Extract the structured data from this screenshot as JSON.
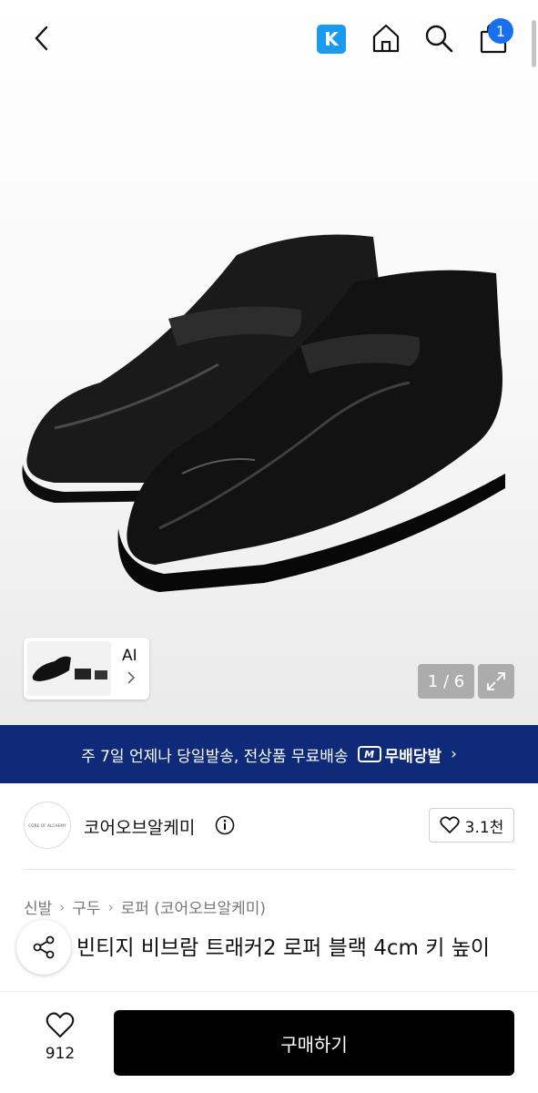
{
  "header": {
    "k_label": "K",
    "cart_count": "1"
  },
  "gallery": {
    "thumb_label": "AI",
    "pager": "1 / 6"
  },
  "banner": {
    "text": "주 7일 언제나 당일발송, 전상품 무료배송",
    "badge_letter": "M",
    "tag": "무배당발",
    "chevron": "›"
  },
  "seller": {
    "logo_text": "CORE OF ALCHEMY",
    "name": "코어오브알케미",
    "likes": "3.1천"
  },
  "breadcrumb": {
    "items": [
      "신발",
      "구두",
      "로퍼 (코어오브알케미)"
    ]
  },
  "product": {
    "title": "빈티지 비브람 트래커2 로퍼 블랙 4cm 키 높이"
  },
  "bottom": {
    "wish_count": "912",
    "buy_label": "구매하기"
  },
  "colors": {
    "banner_bg": "#0e2a78",
    "k_badge": "#1a9bf0",
    "cart_badge": "#1a6ef0",
    "buy_button": "#000000"
  },
  "icons": [
    "chevron-left-icon",
    "home-icon",
    "search-icon",
    "shopping-bag-icon",
    "expand-icon",
    "info-icon",
    "heart-icon",
    "share-icon",
    "chevron-right-icon"
  ]
}
